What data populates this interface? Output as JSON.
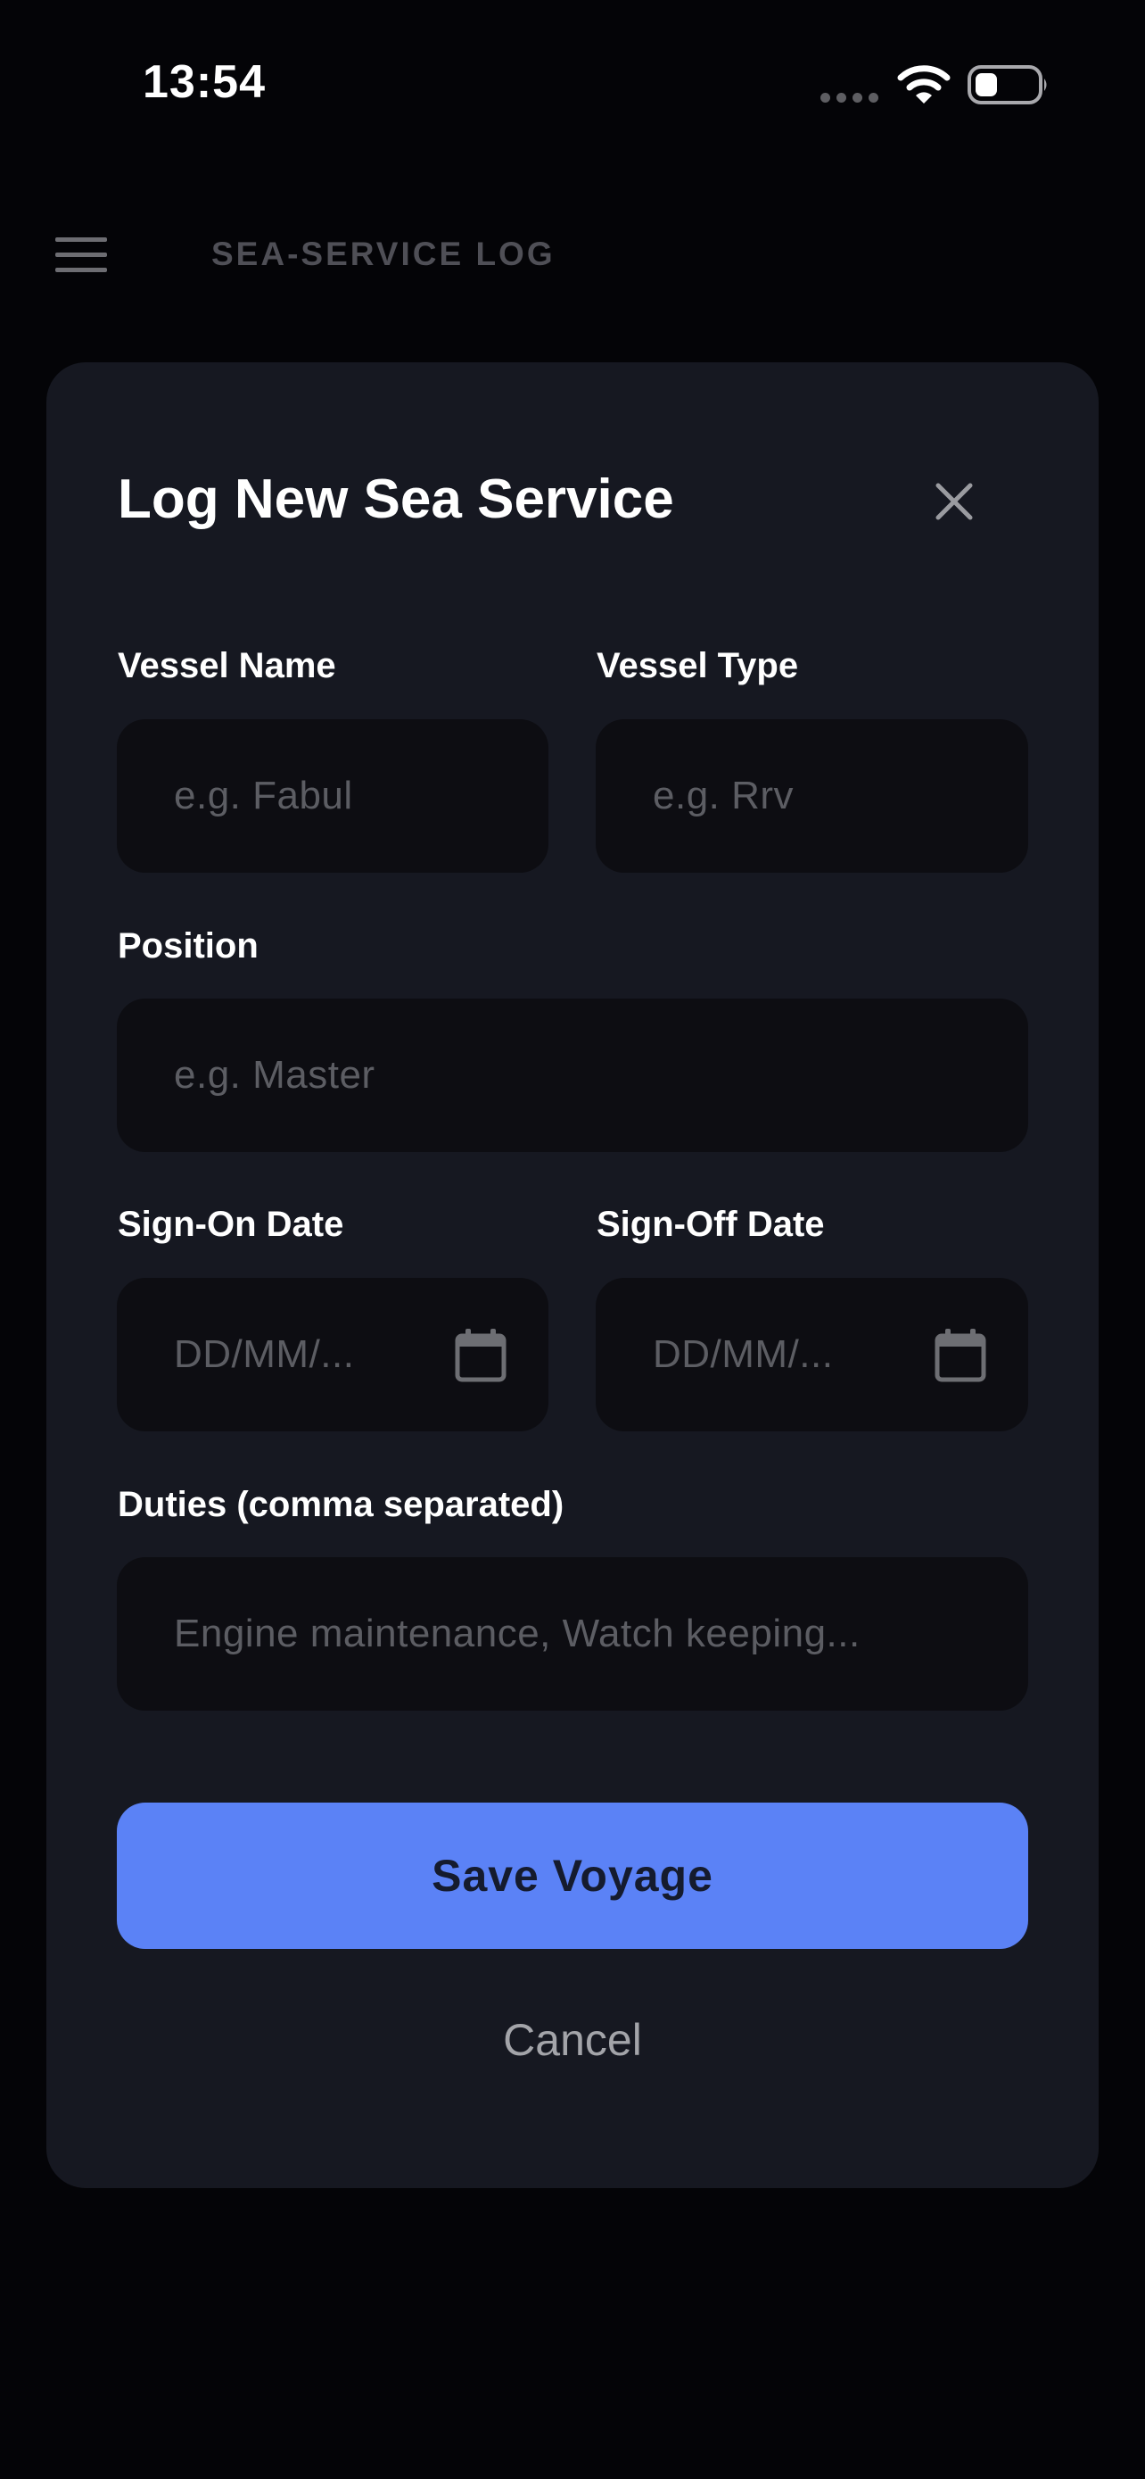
{
  "status_bar": {
    "time": "13:54",
    "icons": [
      "signal-dots-icon",
      "wifi-icon",
      "battery-icon"
    ]
  },
  "header": {
    "menu_icon": "hamburger-menu-icon",
    "title": "SEA-SERVICE LOG"
  },
  "modal": {
    "title": "Log New Sea Service",
    "close_icon": "close-icon",
    "fields": {
      "vessel_name": {
        "label": "Vessel Name",
        "placeholder": "e.g. Fabul",
        "value": ""
      },
      "vessel_type": {
        "label": "Vessel Type",
        "placeholder": "e.g. Rrv",
        "value": ""
      },
      "position": {
        "label": "Position",
        "placeholder": "e.g. Master",
        "value": ""
      },
      "sign_on_date": {
        "label": "Sign-On Date",
        "placeholder": "DD/MM/...",
        "value": "",
        "icon": "calendar-icon"
      },
      "sign_off_date": {
        "label": "Sign-Off Date",
        "placeholder": "DD/MM/...",
        "value": "",
        "icon": "calendar-icon"
      },
      "duties": {
        "label": "Duties (comma separated)",
        "placeholder": "Engine maintenance, Watch keeping...",
        "value": ""
      }
    },
    "save_label": "Save Voyage",
    "cancel_label": "Cancel"
  },
  "colors": {
    "background": "#040407",
    "modal_background": "#161821",
    "input_background": "#0d0d12",
    "accent": "#5b82f6",
    "placeholder": "#5c5d63",
    "header_title": "#4f4f56"
  }
}
